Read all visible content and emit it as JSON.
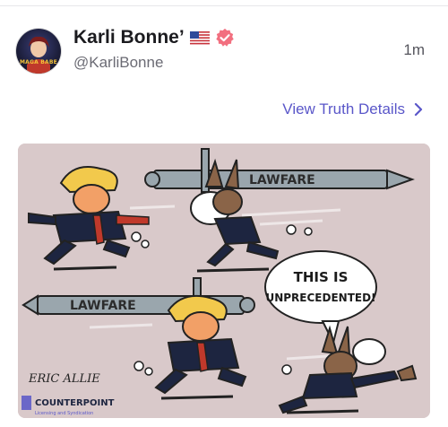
{
  "post": {
    "author_name": "Karli Bonne’",
    "author_handle": "@KarliBonne",
    "timestamp": "1m",
    "avatar_badge_text": "MAGA BABE",
    "view_details_label": "View Truth Details"
  },
  "cartoon": {
    "sword_top_label": "LAWFARE",
    "sword_bottom_label": "LAWFARE",
    "speech_bubble_line1": "THIS IS",
    "speech_bubble_line2": "UNPRECEDENTED!",
    "signature": "ERIC ALLIE",
    "publisher": "COUNTERPOINT",
    "publisher_tagline": "Licensing and Syndication"
  },
  "colors": {
    "accent": "#5a57c9",
    "verified_badge": "#f26f7f",
    "cartoon_background": "#d9c9ca"
  },
  "icons": [
    "us-flag-icon",
    "verified-badge-icon",
    "chevron-right-icon"
  ]
}
